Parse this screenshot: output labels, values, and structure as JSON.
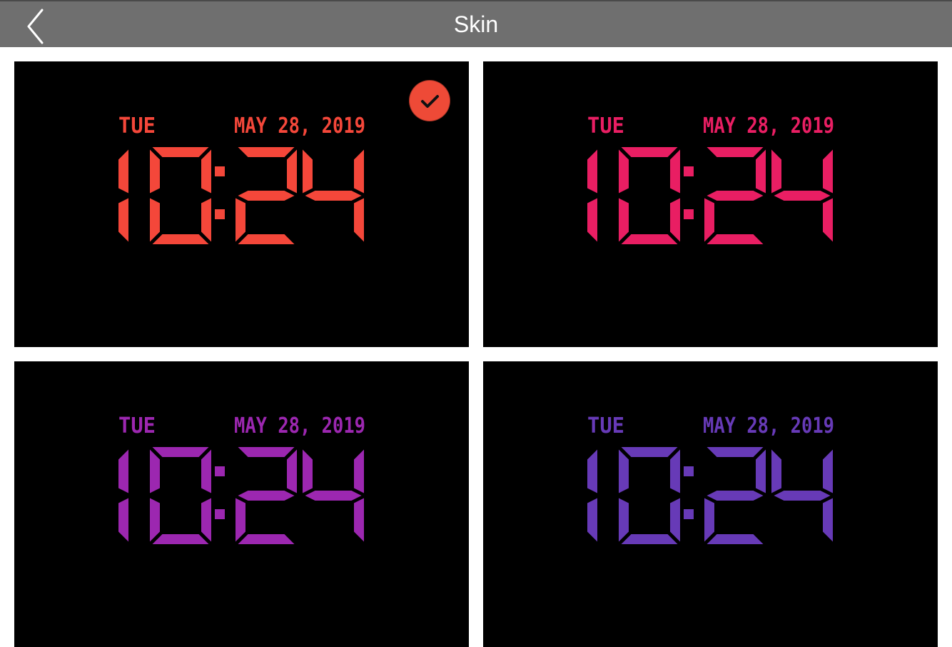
{
  "header": {
    "title": "Skin",
    "back_icon": "chevron-left-icon"
  },
  "skins": [
    {
      "color": "#f4473a",
      "selected": true,
      "day": "TUE",
      "date": "MAY 28, 2019",
      "time": "10:24"
    },
    {
      "color": "#e91e63",
      "selected": false,
      "day": "TUE",
      "date": "MAY 28, 2019",
      "time": "10:24"
    },
    {
      "color": "#9c27b0",
      "selected": false,
      "day": "TUE",
      "date": "MAY 28, 2019",
      "time": "10:24"
    },
    {
      "color": "#673ab7",
      "selected": false,
      "day": "TUE",
      "date": "MAY 28, 2019",
      "time": "10:24"
    }
  ],
  "selected_icon": "checkmark-icon"
}
